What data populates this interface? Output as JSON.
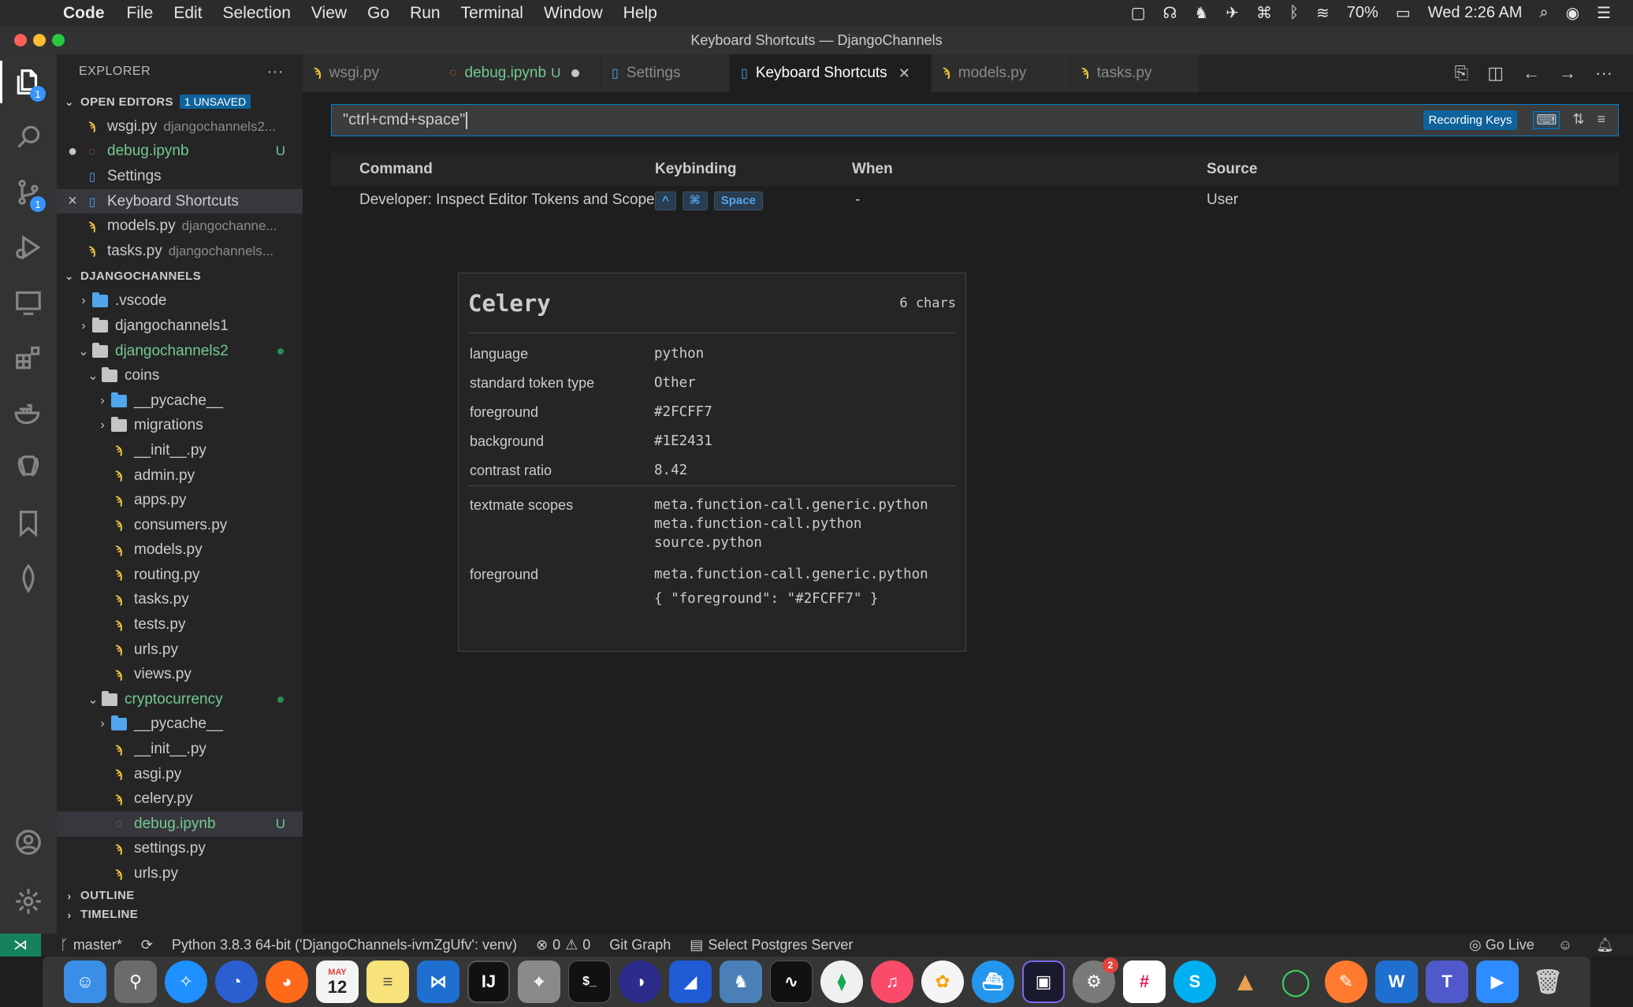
{
  "menubar": {
    "app": "Code",
    "items": [
      "File",
      "Edit",
      "Selection",
      "View",
      "Go",
      "Run",
      "Terminal",
      "Window",
      "Help"
    ],
    "battery": "70%",
    "clock": "Wed 2:26 AM"
  },
  "window": {
    "title": "Keyboard Shortcuts — DjangoChannels"
  },
  "activity": {
    "explorer_badge": "1",
    "scm_badge": "1"
  },
  "sidebar": {
    "title": "EXPLORER",
    "more": "···",
    "open_editors": {
      "label": "OPEN EDITORS",
      "unsaved": "1 UNSAVED",
      "items": [
        {
          "name": "wsgi.py",
          "desc": "djangochannels2...",
          "git": ""
        },
        {
          "name": "debug.ipynb",
          "desc": "",
          "git": "U"
        },
        {
          "name": "Settings",
          "desc": "",
          "git": ""
        },
        {
          "name": "Keyboard Shortcuts",
          "desc": "",
          "git": ""
        },
        {
          "name": "models.py",
          "desc": "djangochanne...",
          "git": ""
        },
        {
          "name": "tasks.py",
          "desc": "djangochannels...",
          "git": ""
        }
      ]
    },
    "project": {
      "label": "DJANGOCHANNELS",
      "items": [
        {
          "name": ".vscode"
        },
        {
          "name": "djangochannels1"
        },
        {
          "name": "djangochannels2"
        },
        {
          "name": "coins"
        },
        {
          "name": "__pycache__"
        },
        {
          "name": "migrations"
        },
        {
          "name": "__init__.py"
        },
        {
          "name": "admin.py"
        },
        {
          "name": "apps.py"
        },
        {
          "name": "consumers.py"
        },
        {
          "name": "models.py"
        },
        {
          "name": "routing.py"
        },
        {
          "name": "tasks.py"
        },
        {
          "name": "tests.py"
        },
        {
          "name": "urls.py"
        },
        {
          "name": "views.py"
        },
        {
          "name": "cryptocurrency"
        },
        {
          "name": "__pycache__"
        },
        {
          "name": "__init__.py"
        },
        {
          "name": "asgi.py"
        },
        {
          "name": "celery.py"
        },
        {
          "name": "debug.ipynb",
          "git": "U"
        },
        {
          "name": "settings.py"
        },
        {
          "name": "urls.py"
        }
      ]
    },
    "outline": "OUTLINE",
    "timeline": "TIMELINE"
  },
  "tabs": [
    {
      "label": "wsgi.py"
    },
    {
      "label": "debug.ipynb",
      "git": "U"
    },
    {
      "label": "Settings"
    },
    {
      "label": "Keyboard Shortcuts"
    },
    {
      "label": "models.py"
    },
    {
      "label": "tasks.py"
    }
  ],
  "keybindings": {
    "search_value": "\"ctrl+cmd+space\"",
    "recording": "Recording Keys",
    "headers": {
      "command": "Command",
      "keybinding": "Keybinding",
      "when": "When",
      "source": "Source"
    },
    "row": {
      "command": "Developer: Inspect Editor Tokens and Scopes",
      "keys": [
        "^",
        "⌘",
        "Space"
      ],
      "when": "-",
      "source": "User"
    }
  },
  "inspect": {
    "token": "Celery",
    "chars": "6 chars",
    "rows": [
      {
        "k": "language",
        "v": "python"
      },
      {
        "k": "standard token type",
        "v": "Other"
      },
      {
        "k": "foreground",
        "v": "#2FCFF7"
      },
      {
        "k": "background",
        "v": "#1E2431"
      },
      {
        "k": "contrast ratio",
        "v": "8.42"
      }
    ],
    "scopes_label": "textmate scopes",
    "scopes": [
      "meta.function-call.generic.python",
      "meta.function-call.python",
      "source.python"
    ],
    "fg_label": "foreground",
    "fg_scope": "meta.function-call.generic.python",
    "fg_rule": "{ \"foreground\": \"#2FCFF7\" }"
  },
  "status": {
    "branch": "master*",
    "python": "Python 3.8.3 64-bit ('DjangoChannels-ivmZgUfv': venv)",
    "errors": "0",
    "warnings": "0",
    "gitgraph": "Git Graph",
    "postgres": "Select Postgres Server",
    "golive": "Go Live"
  },
  "dock": {
    "calendar_month": "MAY",
    "calendar_day": "12",
    "prefs_badge": "2"
  },
  "colors": {
    "accent": "#007fd4",
    "git_untracked": "#73c991",
    "status_remote": "#16825d"
  }
}
